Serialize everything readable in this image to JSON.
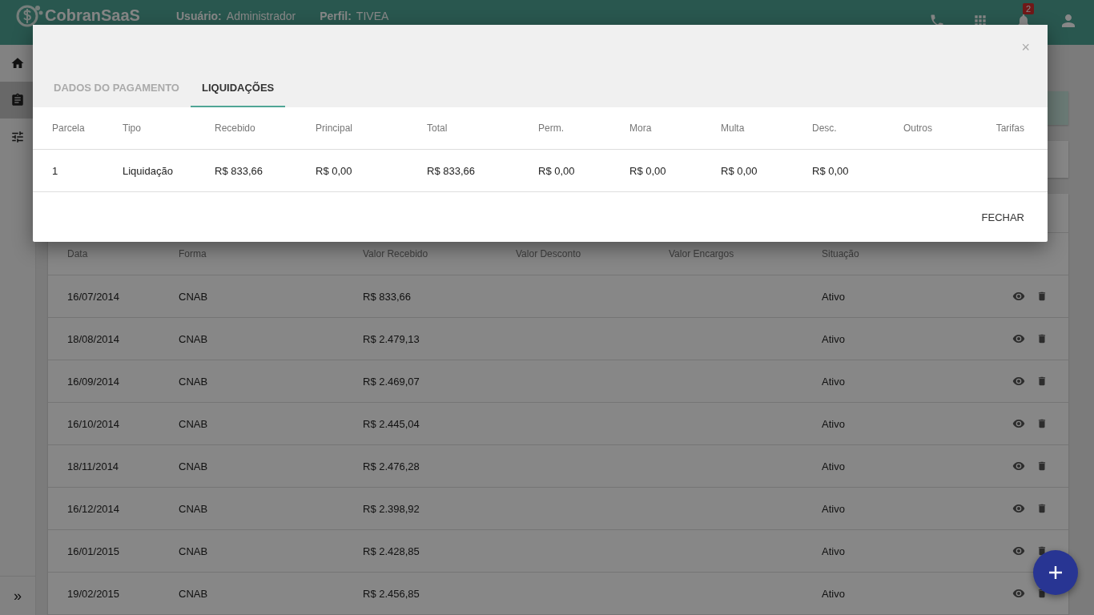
{
  "header": {
    "logo": "CobranSaaS",
    "user_label": "Usuário:",
    "user": "Administrador",
    "profile_label": "Perfil:",
    "profile": "TIVEA",
    "notification_count": "2"
  },
  "sidebar": {
    "items": [
      {
        "kind": "home",
        "selected": false
      },
      {
        "kind": "clipboard",
        "selected": true
      },
      {
        "kind": "tune",
        "selected": false
      }
    ],
    "expand_label": "»"
  },
  "payments": {
    "columns": [
      "Data",
      "Forma",
      "Valor Recebido",
      "Valor Desconto",
      "Valor Encargos",
      "Situação"
    ],
    "rows": [
      {
        "date": "16/07/2014",
        "method": "CNAB",
        "received": "R$ 833,66",
        "status": "Ativo"
      },
      {
        "date": "18/08/2014",
        "method": "CNAB",
        "received": "R$ 2.479,13",
        "status": "Ativo"
      },
      {
        "date": "16/09/2014",
        "method": "CNAB",
        "received": "R$ 2.469,07",
        "status": "Ativo"
      },
      {
        "date": "16/10/2014",
        "method": "CNAB",
        "received": "R$ 2.445,04",
        "status": "Ativo"
      },
      {
        "date": "18/11/2014",
        "method": "CNAB",
        "received": "R$ 2.476,28",
        "status": "Ativo"
      },
      {
        "date": "16/12/2014",
        "method": "CNAB",
        "received": "R$ 2.398,92",
        "status": "Ativo"
      },
      {
        "date": "16/01/2015",
        "method": "CNAB",
        "received": "R$ 2.428,85",
        "status": "Ativo"
      },
      {
        "date": "19/02/2015",
        "method": "CNAB",
        "received": "R$ 2.456,85",
        "status": "Ativo"
      }
    ]
  },
  "modal": {
    "close_icon": "×",
    "tabs": [
      {
        "label": "DADOS DO PAGAMENTO",
        "selected": false
      },
      {
        "label": "LIQUIDAÇÕES",
        "selected": true
      }
    ],
    "columns": [
      "Parcela",
      "Tipo",
      "Recebido",
      "Principal",
      "Total",
      "Perm.",
      "Mora",
      "Multa",
      "Desc.",
      "Outros",
      "Tarifas"
    ],
    "rows": [
      {
        "cells": [
          "1",
          "Liquidação",
          "R$ 833,66",
          "R$ 0,00",
          "R$ 833,66",
          "R$ 0,00",
          "R$ 0,00",
          "R$ 0,00",
          "R$ 0,00"
        ]
      }
    ],
    "close_button": "FECHAR"
  }
}
